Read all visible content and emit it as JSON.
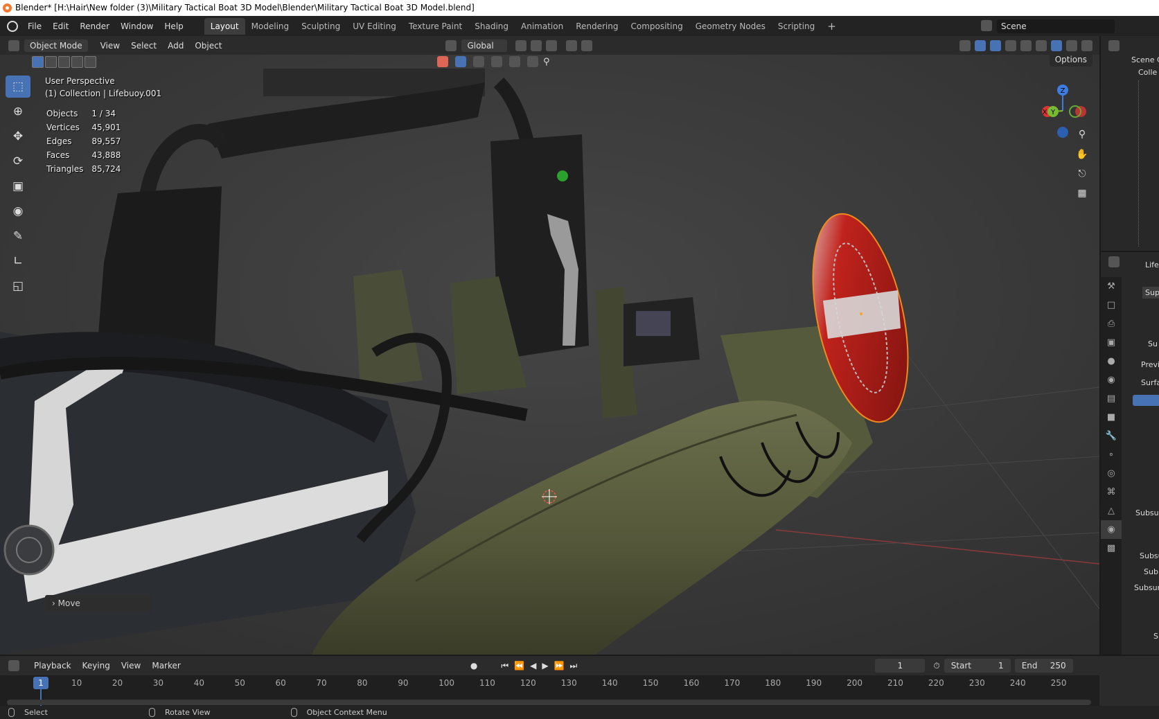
{
  "window": {
    "title": "Blender* [H:\\Hair\\New folder (3)\\Military Tactical Boat 3D Model\\Blender\\Military Tactical Boat 3D Model.blend]"
  },
  "menus": [
    "File",
    "Edit",
    "Render",
    "Window",
    "Help"
  ],
  "workspaces": [
    "Layout",
    "Modeling",
    "Sculpting",
    "UV Editing",
    "Texture Paint",
    "Shading",
    "Animation",
    "Rendering",
    "Compositing",
    "Geometry Nodes",
    "Scripting"
  ],
  "add_workspace": "+",
  "scene": {
    "label": "Scene"
  },
  "viewport_header": {
    "mode": "Object Mode",
    "menus": [
      "View",
      "Select",
      "Add",
      "Object"
    ],
    "orientation": "Global",
    "options": "Options"
  },
  "overlay": {
    "perspective": "User Perspective",
    "collection": "(1) Collection | Lifebuoy.001"
  },
  "stats": [
    {
      "label": "Objects",
      "value": "1 / 34"
    },
    {
      "label": "Vertices",
      "value": "45,901"
    },
    {
      "label": "Edges",
      "value": "89,557"
    },
    {
      "label": "Faces",
      "value": "43,888"
    },
    {
      "label": "Triangles",
      "value": "85,724"
    }
  ],
  "operator_panel": "Move",
  "gizmo": {
    "z": "Z",
    "x": "X",
    "y": "Y"
  },
  "outliner": {
    "scene_collection": "Scene C",
    "collection": "Colle"
  },
  "properties": {
    "object_name": "Lifeb",
    "material": "Sup",
    "shader": "Su",
    "preview": "Previ",
    "surface": "Surfa",
    "sub1": "Subsurf",
    "sub2": "Subsu",
    "sub3": "Sub",
    "sub4": "Subsurfa",
    "sp": "Sp"
  },
  "timeline": {
    "menus": [
      "Playback",
      "Keying",
      "View",
      "Marker"
    ],
    "current_frame": "1",
    "start_label": "Start",
    "start": "1",
    "end_label": "End",
    "end": "250",
    "ticks": [
      "10",
      "20",
      "30",
      "40",
      "50",
      "60",
      "70",
      "80",
      "90",
      "100",
      "110",
      "120",
      "130",
      "140",
      "150",
      "160",
      "170",
      "180",
      "190",
      "200",
      "210",
      "220",
      "230",
      "240",
      "250"
    ]
  },
  "statusbar": [
    "Select",
    "Rotate View",
    "Object Context Menu"
  ]
}
